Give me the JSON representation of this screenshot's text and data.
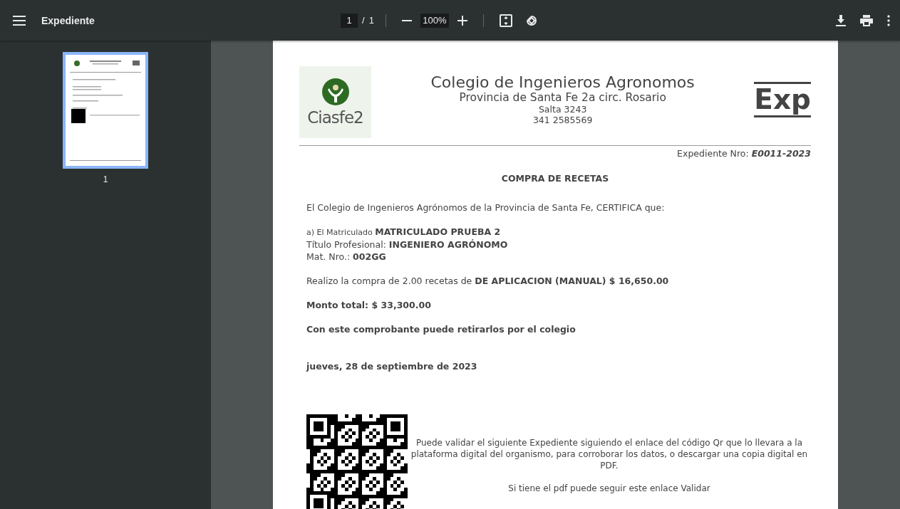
{
  "toolbar": {
    "title": "Expediente",
    "page_current": "1",
    "page_separator": "/",
    "page_total": "1",
    "zoom": "100%"
  },
  "sidebar": {
    "thumbnails": [
      {
        "label": "1",
        "selected": true
      }
    ]
  },
  "document": {
    "logo_text": "Ciasfe2",
    "org_name": "Colegio de Ingenieros Agronomos",
    "org_sub": "Provincia de Santa Fe 2a circ. Rosario",
    "address": "Salta 3243",
    "phone": "341 2585569",
    "stamp": "Exp",
    "file_label": "Expediente Nro:",
    "file_number": "E0011-2023",
    "heading": "COMPRA DE RECETAS",
    "intro": "El Colegio de Ingenieros Agrónomos de la Provincia de Santa Fe, CERTIFICA que:",
    "details": [
      {
        "kind": "small",
        "text": "a) El Matriculado **MATRICULADO PRUEBA 2**"
      },
      {
        "kind": "normal",
        "text": "Título Profesional: **INGENIERO AGRÓNOMO**"
      },
      {
        "kind": "normal",
        "text": "Mat. Nro.: **002GG**"
      }
    ],
    "purchase": "Realizo la compra de 2.00 recetas de **DE APLICACION (MANUAL) $ 16,650.00**",
    "total": "Monto total: $ 33,300.00",
    "note": "Con este comprobante puede retirarlos por el colegio",
    "date": "jueves, 28 de septiembre de 2023",
    "qr_note": "Puede validar el siguiente Expediente siguiendo el enlace del código Qr que lo llevara a la plataforma digital del organismo, para corroborar los datos, o descargar una copia digital en PDF.",
    "validate_text": "Si tiene el pdf puede seguir este enlace",
    "validate_link": "Validar"
  }
}
